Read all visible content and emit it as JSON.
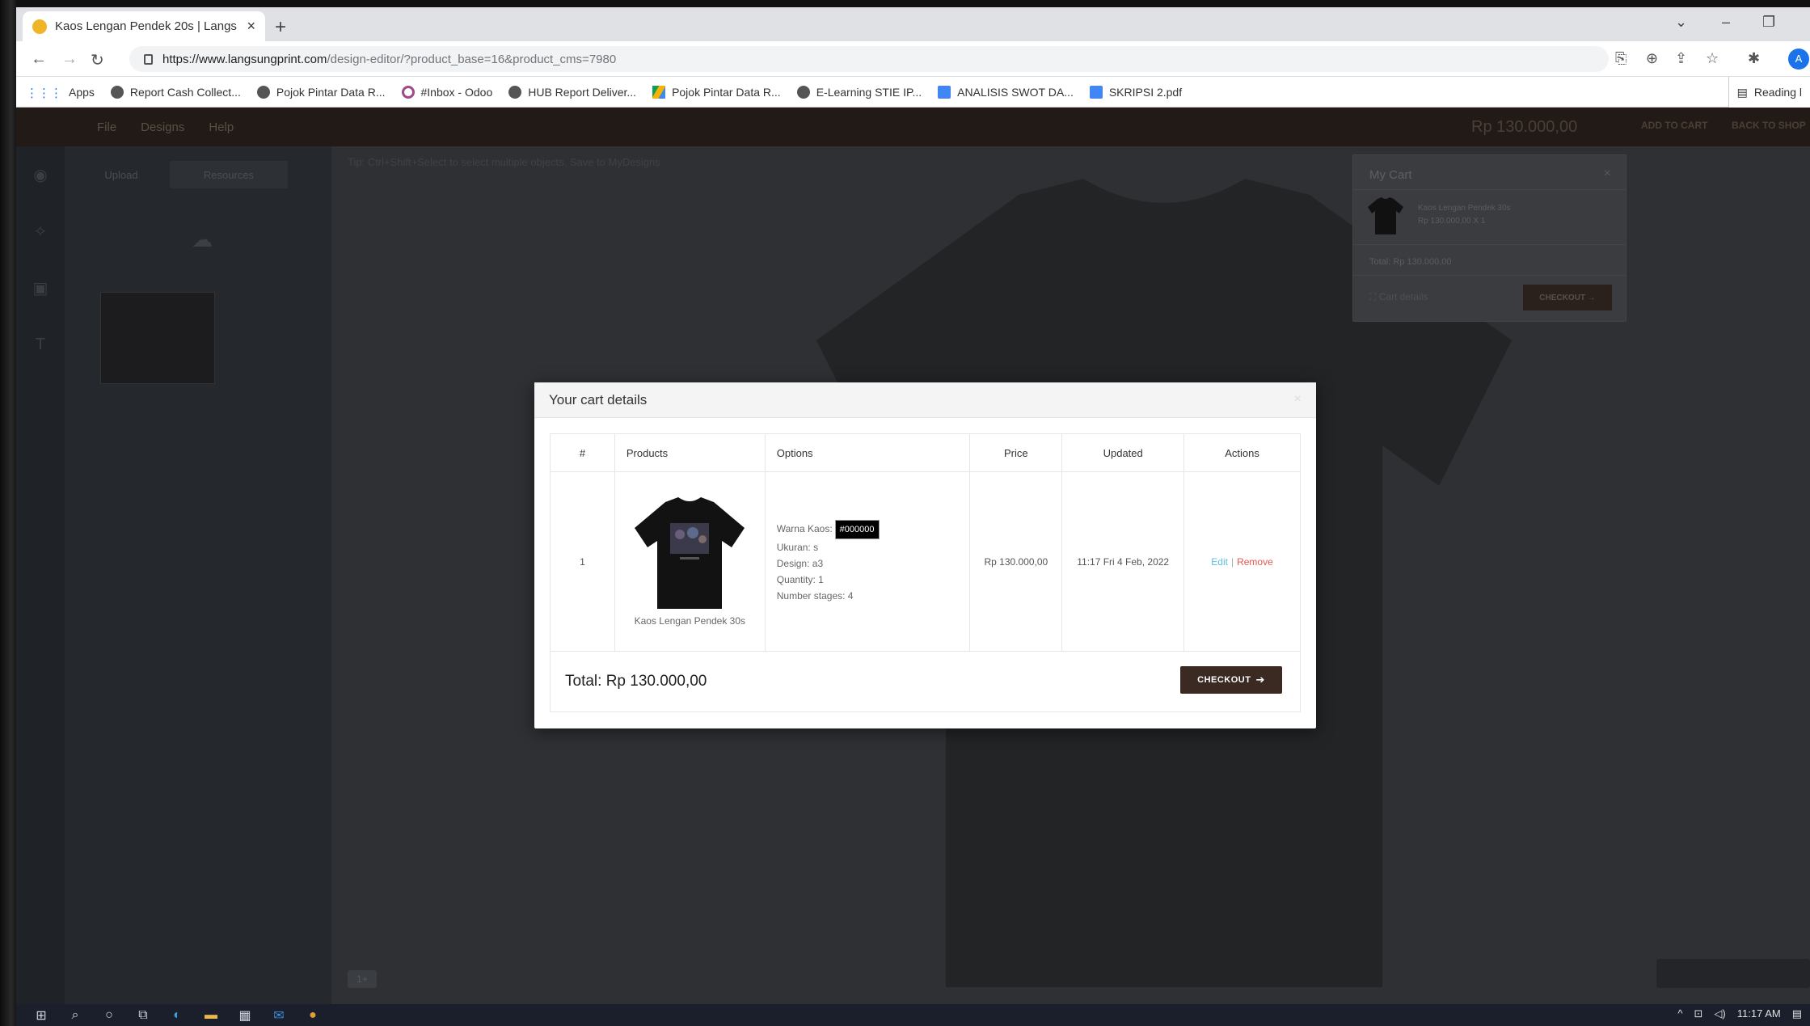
{
  "browser": {
    "tab_title": "Kaos Lengan Pendek 20s | Langs",
    "url_host": "https://www.langsungprint.com",
    "url_path": "/design-editor/?product_base=16&product_cms=7980",
    "profile_initial": "A",
    "bookmarks": [
      "Apps",
      "Report Cash Collect...",
      "Pojok Pintar Data R...",
      "#Inbox - Odoo",
      "HUB Report Deliver...",
      "Pojok Pintar Data R...",
      "E-Learning STIE IP...",
      "ANALISIS SWOT DA...",
      "SKRIPSI 2.pdf"
    ],
    "reading_list": "Reading l"
  },
  "editor": {
    "menu": [
      "File",
      "Designs",
      "Help"
    ],
    "cart_price": "Rp 130.000,00",
    "add_to_cart": "ADD TO CART",
    "back_to_shop": "BACK TO SHOP",
    "panel_tabs": [
      "Upload",
      "Resources"
    ],
    "hint": "Tip: Ctrl+Shift+Select to select multiple objects. Save to MyDesigns",
    "page_indicator": "1+"
  },
  "mini_cart": {
    "title": "My Cart",
    "item_name": "Kaos Lengan Pendek 30s",
    "item_price": "Rp 130.000,00 X 1",
    "total": "Total: Rp 130.000,00",
    "details_link": "Cart details",
    "checkout": "CHECKOUT →"
  },
  "modal": {
    "title": "Your cart details",
    "close": "×",
    "columns": [
      "#",
      "Products",
      "Options",
      "Price",
      "Updated",
      "Actions"
    ],
    "row": {
      "num": "1",
      "product_name": "Kaos Lengan Pendek 30s",
      "options": {
        "warna_label": "Warna Kaos:",
        "warna_value": "#000000",
        "ukuran": "Ukuran: s",
        "design": "Design: a3",
        "quantity": "Quantity: 1",
        "stages": "Number stages: 4"
      },
      "price": "Rp 130.000,00",
      "updated": "11:17 Fri 4 Feb, 2022",
      "edit": "Edit",
      "separator": "|",
      "remove": "Remove"
    },
    "total": "Total: Rp 130.000,00",
    "checkout": "CHECKOUT"
  },
  "taskbar": {
    "time": "11:17 AM"
  },
  "colors": {
    "checkout_bg": "#3b2a22",
    "edit_link": "#5bc0de",
    "remove_link": "#e55353"
  }
}
